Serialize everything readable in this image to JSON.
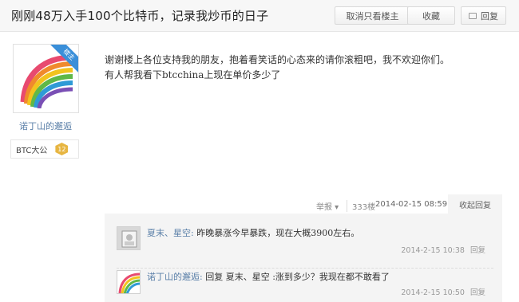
{
  "header": {
    "title": "刚刚48万入手100个比特币，记录我炒币的日子",
    "btn_only_op": "取消只看楼主",
    "btn_favorite": "收藏",
    "btn_reply": "回复"
  },
  "user": {
    "badge": "楼主",
    "name": "诺丁山的邂逅",
    "rank_label": "BTC大公",
    "rank_level": "12"
  },
  "post": {
    "line1": "谢谢楼上各位支持我的朋友，抱着看笑话的心态来的请你滚粗吧，我不欢迎你们。",
    "line2": "有人帮我看下btcchina上现在单价多少了"
  },
  "meta": {
    "report": "举报",
    "floor": "333楼",
    "datetime": "2014-02-15 08:59",
    "collapse_reply": "收起回复"
  },
  "comments": [
    {
      "user": "夏末、星空:",
      "text": "昨晚暴涨今早暴跌，现在大概3900左右。",
      "time": "2014-2-15 10:38",
      "reply_label": "回复"
    },
    {
      "user": "诺丁山的邂逅:",
      "text": "回复 夏末、星空 :涨到多少？我现在都不敢看了",
      "time": "2014-2-15 10:50",
      "reply_label": "回复"
    }
  ]
}
